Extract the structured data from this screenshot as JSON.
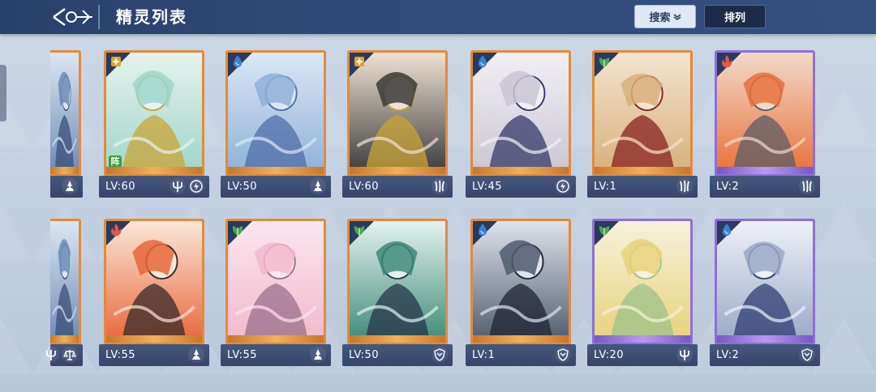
{
  "header": {
    "title": "精灵列表",
    "search_label": "搜索",
    "sort_label": "排列"
  },
  "colors": {
    "orange_frame": "#e38a3b",
    "purple_frame": "#8f6fd6",
    "header_bg": "#2f4a78",
    "fire": "#e2574c",
    "water": "#3b7fd6",
    "wood": "#4aa84a",
    "light": "#e0a030"
  },
  "rows": [
    {
      "partial": {
        "icons": [
          "mage-icon"
        ]
      },
      "cards": [
        {
          "level": "LV:60",
          "element": "light",
          "rarity": "orange",
          "formation": "阵",
          "icons": [
            "trident-icon",
            "lightning-icon"
          ],
          "palette": [
            "#e6f2ee",
            "#9ed6c9",
            "#c9a437"
          ]
        },
        {
          "level": "LV:50",
          "element": "water",
          "rarity": "orange",
          "icons": [
            "mage-icon"
          ],
          "palette": [
            "#dbe8f5",
            "#8fb0d8",
            "#4d6ea8"
          ]
        },
        {
          "level": "LV:60",
          "element": "light",
          "rarity": "orange",
          "icons": [
            "claw-icon"
          ],
          "palette": [
            "#efe2d2",
            "#3a3a3a",
            "#c9a437"
          ]
        },
        {
          "level": "LV:45",
          "element": "water",
          "rarity": "orange",
          "icons": [
            "lightning-icon"
          ],
          "palette": [
            "#f2f0f5",
            "#c9c6d2",
            "#34386a"
          ]
        },
        {
          "level": "LV:1",
          "element": "wood",
          "rarity": "orange",
          "icons": [
            "claw-icon"
          ],
          "palette": [
            "#f3e4cf",
            "#d7b07c",
            "#8a2020"
          ]
        },
        {
          "level": "LV:2",
          "element": "fire",
          "rarity": "purple",
          "icons": [
            "claw-icon"
          ],
          "palette": [
            "#f2d9c8",
            "#e8703a",
            "#5c5c66"
          ]
        }
      ]
    },
    {
      "partial": {
        "icons": [
          "trident-icon",
          "scale-icon"
        ]
      },
      "cards": [
        {
          "level": "LV:55",
          "element": "fire",
          "rarity": "orange",
          "icons": [
            "mage-icon"
          ],
          "palette": [
            "#fae7d8",
            "#e8663a",
            "#3a2a2a"
          ]
        },
        {
          "level": "LV:55",
          "element": "wood",
          "rarity": "orange",
          "icons": [
            "mage-icon"
          ],
          "palette": [
            "#fbe6ee",
            "#f2b8cc",
            "#9a6f8a"
          ]
        },
        {
          "level": "LV:50",
          "element": "wood",
          "rarity": "orange",
          "icons": [
            "shield-icon"
          ],
          "palette": [
            "#e3f2ee",
            "#3e8a78",
            "#26364a"
          ]
        },
        {
          "level": "LV:1",
          "element": "water",
          "rarity": "orange",
          "icons": [
            "shield-icon"
          ],
          "palette": [
            "#dfe3ea",
            "#505a6e",
            "#1f2433"
          ]
        },
        {
          "level": "LV:20",
          "element": "wood",
          "rarity": "purple",
          "icons": [
            "trident-icon"
          ],
          "palette": [
            "#f6f2dc",
            "#e8d27a",
            "#9cc28a"
          ]
        },
        {
          "level": "LV:2",
          "element": "water",
          "rarity": "purple",
          "icons": [
            "shield-icon"
          ],
          "palette": [
            "#eef1f7",
            "#9aa8c6",
            "#2d3d72"
          ]
        }
      ]
    }
  ]
}
